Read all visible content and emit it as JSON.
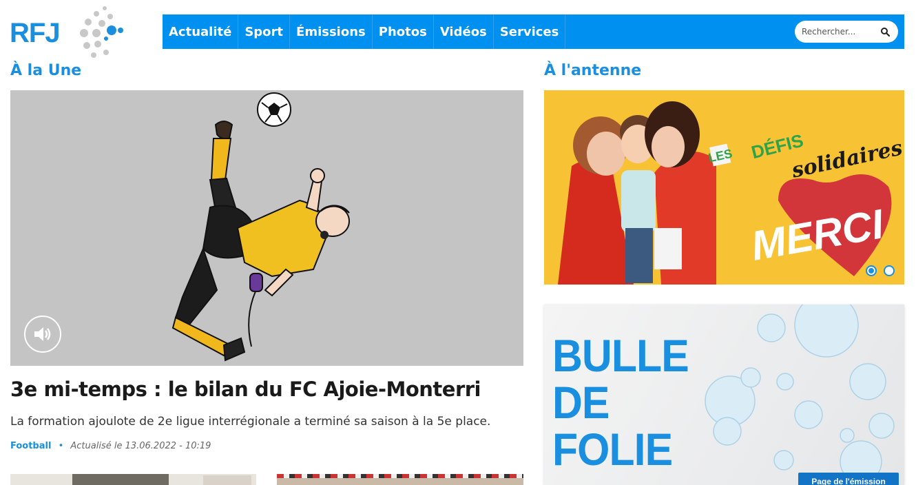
{
  "brand": {
    "logo_text": "RFJ",
    "accent": "#0090f0"
  },
  "nav": {
    "items": [
      "Actualité",
      "Sport",
      "Émissions",
      "Photos",
      "Vidéos",
      "Services"
    ],
    "search_placeholder": "Rechercher..."
  },
  "sections": {
    "une": "À la Une",
    "antenne": "À l'antenne"
  },
  "article": {
    "title": "3e mi-temps : le bilan du FC Ajoie-Monterri",
    "lead": "La formation ajoulote de 2e ligue interrégionale a terminé sa saison à la 5e place.",
    "category": "Football",
    "separator": "•",
    "date": "Actualisé le 13.06.2022 - 10:19"
  },
  "antenne": {
    "line1": "LES",
    "line2": "DÉFIS",
    "line3": "solidaires",
    "merci": "MERCI",
    "slides": 2,
    "active_slide": 1
  },
  "bulle": {
    "line1": "BULLE",
    "line2": "DE",
    "line3": "FOLIE",
    "button": "Page de l'émission"
  }
}
